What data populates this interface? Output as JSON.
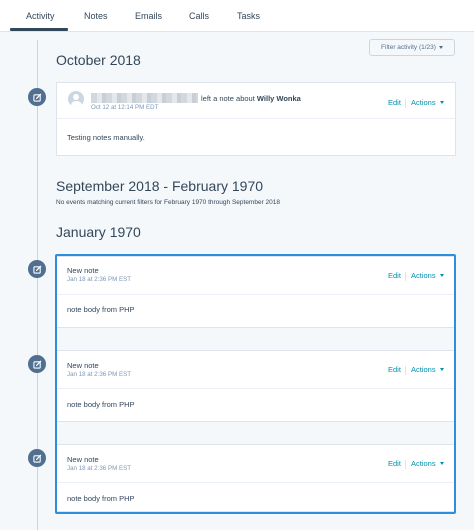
{
  "tabs": [
    {
      "label": "Activity",
      "active": true
    },
    {
      "label": "Notes",
      "active": false
    },
    {
      "label": "Emails",
      "active": false
    },
    {
      "label": "Calls",
      "active": false
    },
    {
      "label": "Tasks",
      "active": false
    }
  ],
  "filter": {
    "label": "Filter activity (1/23)"
  },
  "sections": {
    "oct2018": "October 2018",
    "range": "September 2018 - February 1970",
    "range_empty": "No events matching current filters for February 1970 through September 2018",
    "jan1970": "January 1970"
  },
  "notes": [
    {
      "author_suffix": "left a note about",
      "about": "Willy Wonka",
      "timestamp": "Oct 12 at 12:14 PM EDT",
      "body": "Testing notes manually.",
      "edit": "Edit",
      "actions": "Actions"
    },
    {
      "title": "New note",
      "timestamp": "Jan 18 at 2:36 PM EST",
      "body": "note body from PHP",
      "edit": "Edit",
      "actions": "Actions"
    },
    {
      "title": "New note",
      "timestamp": "Jan 18 at 2:36 PM EST",
      "body": "note body from PHP",
      "edit": "Edit",
      "actions": "Actions"
    },
    {
      "title": "New note",
      "timestamp": "Jan 18 at 2:36 PM EST",
      "body": "note body from PHP",
      "edit": "Edit",
      "actions": "Actions"
    }
  ],
  "icons": {
    "timeline": "note-edit-icon",
    "caret": "caret-down-icon",
    "avatar": "user-avatar"
  },
  "colors": {
    "accent": "#0091ae",
    "icon_bg": "#516f90",
    "highlight": "#2b8fe0",
    "background": "#f5f8fa"
  }
}
